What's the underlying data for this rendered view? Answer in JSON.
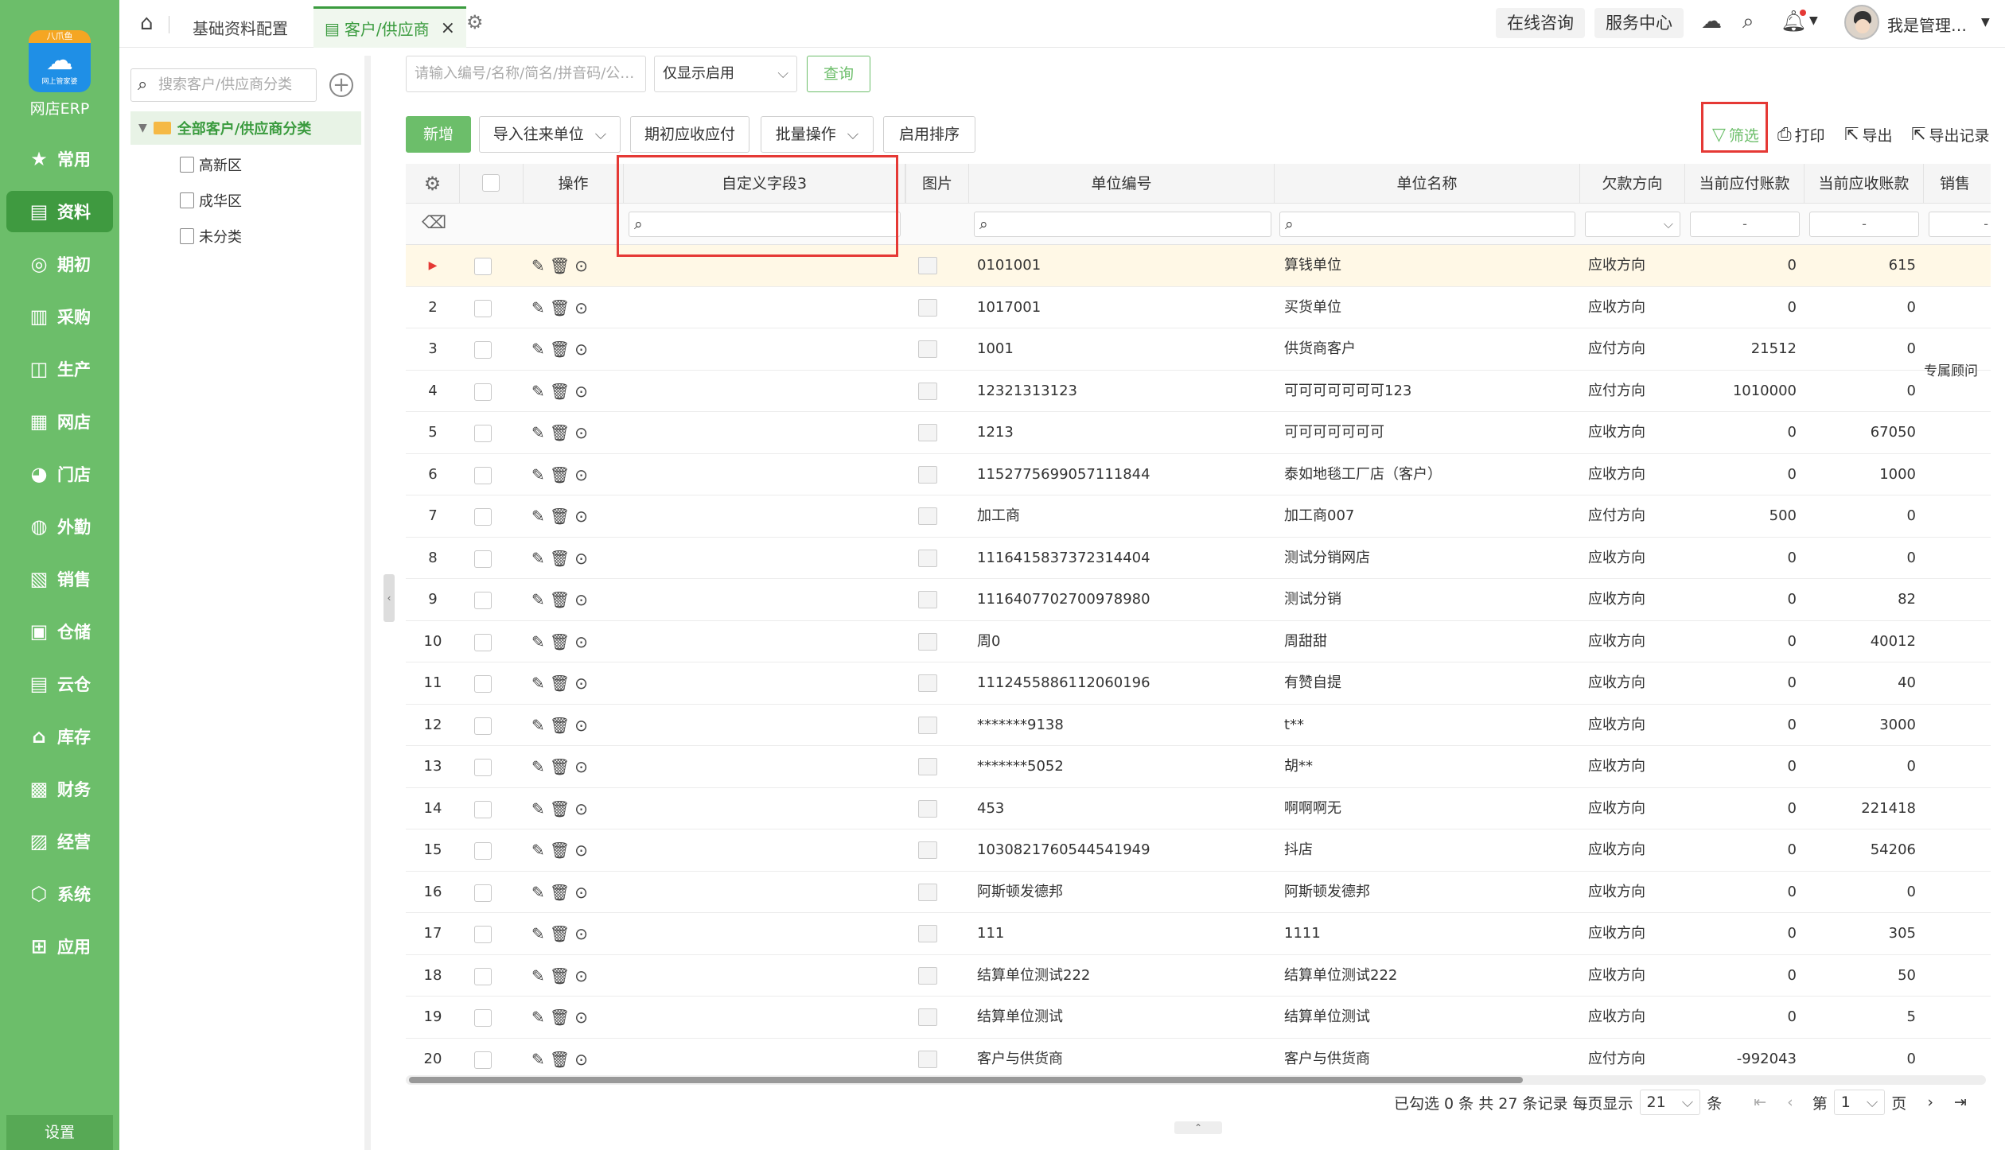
{
  "app": {
    "logo_badge": "八爪鱼",
    "logo_sub": "网上管家婆",
    "brand": "网店ERP",
    "settings": "设置",
    "accent": "#6cbe6a"
  },
  "menu": [
    {
      "icon": "star-icon",
      "glyph": "★",
      "label": "常用"
    },
    {
      "icon": "document-icon",
      "glyph": "▤",
      "label": "资料"
    },
    {
      "icon": "target-icon",
      "glyph": "◎",
      "label": "期初"
    },
    {
      "icon": "cart-icon",
      "glyph": "▥",
      "label": "采购"
    },
    {
      "icon": "factory-icon",
      "glyph": "◫",
      "label": "生产"
    },
    {
      "icon": "shop-icon",
      "glyph": "▦",
      "label": "网店"
    },
    {
      "icon": "store-icon",
      "glyph": "◕",
      "label": "门店"
    },
    {
      "icon": "outsource-icon",
      "glyph": "◍",
      "label": "外勤"
    },
    {
      "icon": "sales-icon",
      "glyph": "▧",
      "label": "销售"
    },
    {
      "icon": "warehouse-icon",
      "glyph": "▣",
      "label": "仓储"
    },
    {
      "icon": "cloud-warehouse-icon",
      "glyph": "▤",
      "label": "云仓"
    },
    {
      "icon": "inventory-icon",
      "glyph": "⌂",
      "label": "库存"
    },
    {
      "icon": "finance-icon",
      "glyph": "▩",
      "label": "财务"
    },
    {
      "icon": "business-icon",
      "glyph": "▨",
      "label": "经营"
    },
    {
      "icon": "system-icon",
      "glyph": "⬡",
      "label": "系统"
    },
    {
      "icon": "apps-icon",
      "glyph": "⊞",
      "label": "应用"
    }
  ],
  "tabs": {
    "base": "基础资料配置",
    "active": "客户/供应商",
    "close": "×"
  },
  "top_right": {
    "consult": "在线咨询",
    "service": "服务中心",
    "user": "我是管理…"
  },
  "tree": {
    "search_placeholder": "搜索客户/供应商分类",
    "root": "全部客户/供应商分类",
    "nodes": [
      "高新区",
      "成华区",
      "未分类"
    ]
  },
  "search": {
    "placeholder": "请输入编号/名称/简名/拼音码/公…",
    "filter_value": "仅显示启用",
    "query": "查询"
  },
  "toolbar": {
    "new": "新增",
    "import": "导入往来单位",
    "initial": "期初应收应付",
    "batch": "批量操作",
    "sort": "启用排序",
    "filter": "筛选",
    "print": "打印",
    "export": "导出",
    "export_log": "导出记录"
  },
  "columns": {
    "op": "操作",
    "custom3": "自定义字段3",
    "image": "图片",
    "code": "单位编号",
    "name": "单位名称",
    "direction": "欠款方向",
    "payable": "当前应付账款",
    "receivable": "当前应收账款",
    "sales": "销售"
  },
  "filters": {
    "dash": "-"
  },
  "rows": [
    {
      "n": "1",
      "code": "0101001",
      "name": "算钱单位",
      "dir": "应收方向",
      "pay": "0",
      "rec": "615"
    },
    {
      "n": "2",
      "code": "1017001",
      "name": "买货单位",
      "dir": "应收方向",
      "pay": "0",
      "rec": "0"
    },
    {
      "n": "3",
      "code": "1001",
      "name": "供货商客户",
      "dir": "应付方向",
      "pay": "21512",
      "rec": "0"
    },
    {
      "n": "4",
      "code": "12321313123",
      "name": "可可可可可可可123",
      "dir": "应付方向",
      "pay": "1010000",
      "rec": "0"
    },
    {
      "n": "5",
      "code": "1213",
      "name": "可可可可可可可",
      "dir": "应收方向",
      "pay": "0",
      "rec": "67050"
    },
    {
      "n": "6",
      "code": "1152775699057111844",
      "name": "泰如地毯工厂店（客户）",
      "dir": "应收方向",
      "pay": "0",
      "rec": "1000"
    },
    {
      "n": "7",
      "code": "加工商",
      "name": "加工商007",
      "dir": "应付方向",
      "pay": "500",
      "rec": "0"
    },
    {
      "n": "8",
      "code": "1116415837372314404",
      "name": "测试分销网店",
      "dir": "应收方向",
      "pay": "0",
      "rec": "0"
    },
    {
      "n": "9",
      "code": "1116407702700978980",
      "name": "测试分销",
      "dir": "应收方向",
      "pay": "0",
      "rec": "82"
    },
    {
      "n": "10",
      "code": "周0",
      "name": "周甜甜",
      "dir": "应收方向",
      "pay": "0",
      "rec": "40012"
    },
    {
      "n": "11",
      "code": "1112455886112060196",
      "name": "有赞自提",
      "dir": "应收方向",
      "pay": "0",
      "rec": "40"
    },
    {
      "n": "12",
      "code": "*******9138",
      "name": "t**",
      "dir": "应收方向",
      "pay": "0",
      "rec": "3000"
    },
    {
      "n": "13",
      "code": "*******5052",
      "name": "胡**",
      "dir": "应收方向",
      "pay": "0",
      "rec": "0"
    },
    {
      "n": "14",
      "code": "453",
      "name": "啊啊啊无",
      "dir": "应收方向",
      "pay": "0",
      "rec": "221418"
    },
    {
      "n": "15",
      "code": "1030821760544541949",
      "name": "抖店",
      "dir": "应收方向",
      "pay": "0",
      "rec": "54206"
    },
    {
      "n": "16",
      "code": "阿斯顿发德邦",
      "name": "阿斯顿发德邦",
      "dir": "应收方向",
      "pay": "0",
      "rec": "0"
    },
    {
      "n": "17",
      "code": "111",
      "name": "1111",
      "dir": "应收方向",
      "pay": "0",
      "rec": "305"
    },
    {
      "n": "18",
      "code": "结算单位测试222",
      "name": "结算单位测试222",
      "dir": "应收方向",
      "pay": "0",
      "rec": "50"
    },
    {
      "n": "19",
      "code": "结算单位测试",
      "name": "结算单位测试",
      "dir": "应收方向",
      "pay": "0",
      "rec": "5"
    },
    {
      "n": "20",
      "code": "客户与供货商",
      "name": "客户与供货商",
      "dir": "应付方向",
      "pay": "-992043",
      "rec": "0"
    }
  ],
  "side_label": "专属顾问",
  "pager": {
    "selected": "已勾选 0 条",
    "total": "共 27 条记录",
    "per_page_label": "每页显示",
    "per_page": "21",
    "unit": "条",
    "page_label": "第",
    "page": "1",
    "page_suffix": "页"
  }
}
